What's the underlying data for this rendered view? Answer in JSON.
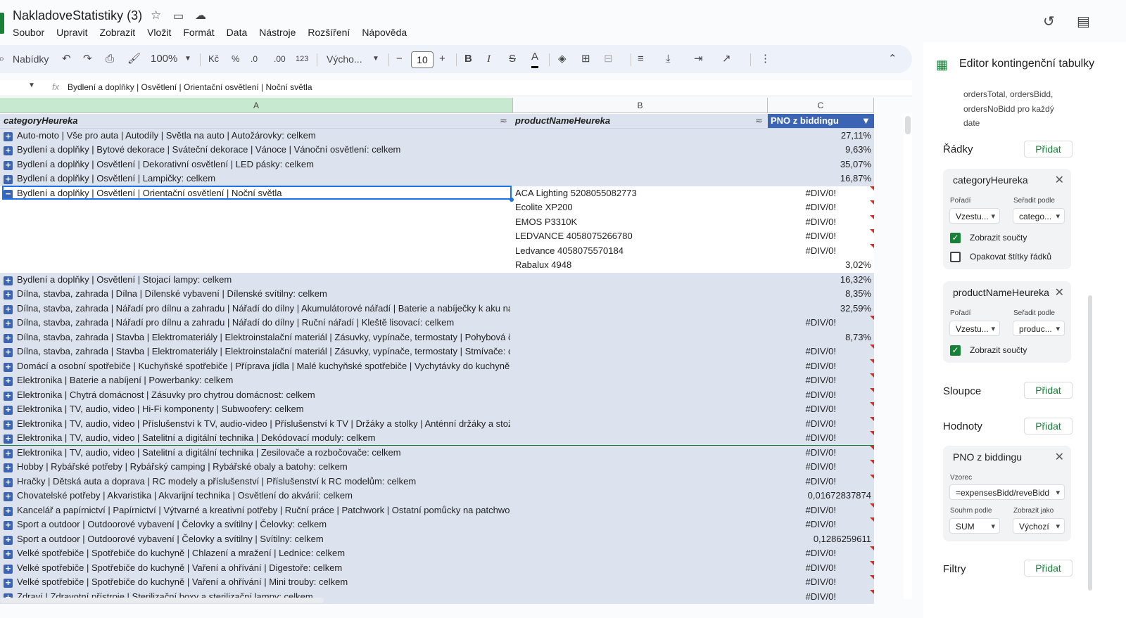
{
  "app": {
    "doc_title": "NakladoveStatistiky (3)",
    "menu": [
      "Soubor",
      "Upravit",
      "Zobrazit",
      "Vložit",
      "Formát",
      "Data",
      "Nástroje",
      "Rozšíření",
      "Nápověda"
    ]
  },
  "toolbar": {
    "search_label": "Nabídky",
    "zoom": "100%",
    "currency": "Kč",
    "percent": "%",
    "decrease_decimals": ".0",
    "increase_decimals": ".00",
    "number_format": "123",
    "font_name": "Výcho...",
    "font_size": "10",
    "bold": "B",
    "italic": "I",
    "strike": "S",
    "text_color": "A"
  },
  "formula_bar": {
    "content": "Bydlení a doplňky | Osvětlení | Orientační osvětlení | Noční světla"
  },
  "columns": [
    "A",
    "B",
    "C"
  ],
  "table": {
    "headers": [
      "categoryHeureka",
      "productNameHeureka",
      "PNO z biddingu"
    ],
    "rows": [
      {
        "a": "Auto-moto | Vše pro auta | Autodíly | Světla na auto | Autožárovky: celkem",
        "b": "",
        "c": "27,11%",
        "tgl": "+",
        "err": false
      },
      {
        "a": "Bydlení a doplňky | Bytové dekorace | Sváteční dekorace | Vánoce | Vánoční osvětlení: celkem",
        "b": "",
        "c": "9,63%",
        "tgl": "+",
        "err": false
      },
      {
        "a": "Bydlení a doplňky | Osvětlení | Dekorativní osvětlení | LED pásky: celkem",
        "b": "",
        "c": "35,07%",
        "tgl": "+",
        "err": false
      },
      {
        "a": "Bydlení a doplňky | Osvětlení | Lampičky: celkem",
        "b": "",
        "c": "16,87%",
        "tgl": "+",
        "err": false
      },
      {
        "a": "Bydlení a doplňky | Osvětlení | Orientační osvětlení | Noční světla",
        "b": "ACA Lighting 5208055082773",
        "c": "#DIV/0!",
        "tgl": "−",
        "err": true
      },
      {
        "a": "",
        "b": "Ecolite XP200",
        "c": "#DIV/0!",
        "tgl": "",
        "err": true
      },
      {
        "a": "",
        "b": "EMOS P3310K",
        "c": "#DIV/0!",
        "tgl": "",
        "err": true
      },
      {
        "a": "",
        "b": "LEDVANCE 4058075266780",
        "c": "#DIV/0!",
        "tgl": "",
        "err": true
      },
      {
        "a": "",
        "b": "Ledvance 4058075570184",
        "c": "#DIV/0!",
        "tgl": "",
        "err": true
      },
      {
        "a": "",
        "b": "Rabalux 4948",
        "c": "3,02%",
        "tgl": "",
        "err": false
      },
      {
        "a": "Bydlení a doplňky | Osvětlení | Stojací lampy: celkem",
        "b": "",
        "c": "16,32%",
        "tgl": "+",
        "err": false
      },
      {
        "a": "Dílna, stavba, zahrada | Dílna | Dílenské vybavení | Dílenské svítilny: celkem",
        "b": "",
        "c": "8,35%",
        "tgl": "+",
        "err": false
      },
      {
        "a": "Dílna, stavba, zahrada | Nářadí pro dílnu a zahradu | Nářadí do dílny | Akumulátorové nářadí | Baterie a nabíječky k aku nářadí | Baterie k aku nářadí - originální: celkem",
        "b": "",
        "c": "32,59%",
        "tgl": "+",
        "err": false
      },
      {
        "a": "Dílna, stavba, zahrada | Nářadí pro dílnu a zahradu | Nářadí do dílny | Ruční nářadí | Kleště lisovací: celkem",
        "b": "",
        "c": "#DIV/0!",
        "tgl": "+",
        "err": true
      },
      {
        "a": "Dílna, stavba, zahrada | Stavba | Elektromateriály | Elektroinstalační materiál | Zásuvky, vypínače, termostaty | Pohybová čidla: celkem",
        "b": "",
        "c": "8,73%",
        "tgl": "+",
        "err": false
      },
      {
        "a": "Dílna, stavba, zahrada | Stavba | Elektromateriály | Elektroinstalační materiál | Zásuvky, vypínače, termostaty | Stmívače: celkem",
        "b": "",
        "c": "#DIV/0!",
        "tgl": "+",
        "err": true
      },
      {
        "a": "Domácí a osobní spotřebiče | Kuchyňské spotřebiče | Příprava jídla | Malé kuchyňské spotřebiče | Vychytávky do kuchyně | Zmrzlinovače: celkem",
        "b": "",
        "c": "#DIV/0!",
        "tgl": "+",
        "err": true
      },
      {
        "a": "Elektronika | Baterie a nabíjení | Powerbanky: celkem",
        "b": "",
        "c": "#DIV/0!",
        "tgl": "+",
        "err": true
      },
      {
        "a": "Elektronika | Chytrá domácnost | Zásuvky pro chytrou domácnost: celkem",
        "b": "",
        "c": "#DIV/0!",
        "tgl": "+",
        "err": true
      },
      {
        "a": "Elektronika | TV, audio, video | Hi-Fi komponenty | Subwoofery: celkem",
        "b": "",
        "c": "#DIV/0!",
        "tgl": "+",
        "err": true
      },
      {
        "a": "Elektronika | TV, audio, video | Příslušenství k TV, audio-video | Příslušenství k TV | Držáky a stolky | Anténní držáky a stožáry: celkem",
        "b": "",
        "c": "#DIV/0!",
        "tgl": "+",
        "err": true
      },
      {
        "a": "Elektronika | TV, audio, video | Satelitní a digitální technika | Dekódovací moduly: celkem",
        "b": "",
        "c": "#DIV/0!",
        "tgl": "+",
        "err": true
      },
      {
        "a": "Elektronika | TV, audio, video | Satelitní a digitální technika | Zesilovače a rozbočovače: celkem",
        "b": "",
        "c": "#DIV/0!",
        "tgl": "+",
        "err": true
      },
      {
        "a": "Hobby | Rybářské potřeby | Rybářský camping | Rybářské obaly a batohy: celkem",
        "b": "",
        "c": "#DIV/0!",
        "tgl": "+",
        "err": true
      },
      {
        "a": "Hračky | Dětská auta a doprava | RC modely a příslušenství | Příslušenství k RC modelům: celkem",
        "b": "",
        "c": "#DIV/0!",
        "tgl": "+",
        "err": true
      },
      {
        "a": "Chovatelské potřeby | Akvaristika | Akvarijní technika | Osvětlení do akvárií: celkem",
        "b": "",
        "c": "0,01672837874",
        "tgl": "+",
        "err": false
      },
      {
        "a": "Kancelář a papírnictví | Papírnictví | Výtvarné a kreativní potřeby | Ruční práce | Patchwork | Ostatní pomůcky na patchwork: celkem",
        "b": "",
        "c": "#DIV/0!",
        "tgl": "+",
        "err": true
      },
      {
        "a": "Sport a outdoor | Outdoorové vybavení | Čelovky a svítilny | Čelovky: celkem",
        "b": "",
        "c": "#DIV/0!",
        "tgl": "+",
        "err": true
      },
      {
        "a": "Sport a outdoor | Outdoorové vybavení | Čelovky a svítilny | Svítilny: celkem",
        "b": "",
        "c": "0,1286259611",
        "tgl": "+",
        "err": false
      },
      {
        "a": "Velké spotřebiče | Spotřebiče do kuchyně | Chlazení a mražení | Lednice: celkem",
        "b": "",
        "c": "#DIV/0!",
        "tgl": "+",
        "err": true
      },
      {
        "a": "Velké spotřebiče | Spotřebiče do kuchyně | Vaření a ohřívání | Digestoře: celkem",
        "b": "",
        "c": "#DIV/0!",
        "tgl": "+",
        "err": true
      },
      {
        "a": "Velké spotřebiče | Spotřebiče do kuchyně | Vaření a ohřívání | Mini trouby: celkem",
        "b": "",
        "c": "#DIV/0!",
        "tgl": "+",
        "err": true
      },
      {
        "a": "Zdraví | Zdravotní přístroje | Sterilizační boxy a sterilizační lampy: celkem",
        "b": "",
        "c": "#DIV/0!",
        "tgl": "+",
        "err": true
      }
    ]
  },
  "pivot_editor": {
    "title": "Editor kontingenční tabulky",
    "intro_lines": [
      "ordersTotal, ordersBidd,",
      "ordersNoBidd pro každý",
      "date"
    ],
    "add_label": "Přidat",
    "rows_label": "Řádky",
    "columns_label": "Sloupce",
    "values_label": "Hodnoty",
    "filters_label": "Filtry",
    "row_field_1": {
      "name": "categoryHeureka",
      "order_label": "Pořadí",
      "sort_by_label": "Seřadit podle",
      "order_value": "Vzestu...",
      "sort_by_value": "catego...",
      "show_totals": "Zobrazit součty",
      "repeat_labels": "Opakovat štítky řádků"
    },
    "row_field_2": {
      "name": "productNameHeureka",
      "order_label": "Pořadí",
      "sort_by_label": "Seřadit podle",
      "order_value": "Vzestu...",
      "sort_by_value": "produc...",
      "show_totals": "Zobrazit součty"
    },
    "value_field": {
      "name": "PNO z biddingu",
      "formula_label": "Vzorec",
      "formula": "=expensesBidd/reveBidd",
      "summarize_label": "Souhrn podle",
      "show_as_label": "Zobrazit jako",
      "summarize_value": "SUM",
      "show_as_value": "Výchozí"
    }
  }
}
